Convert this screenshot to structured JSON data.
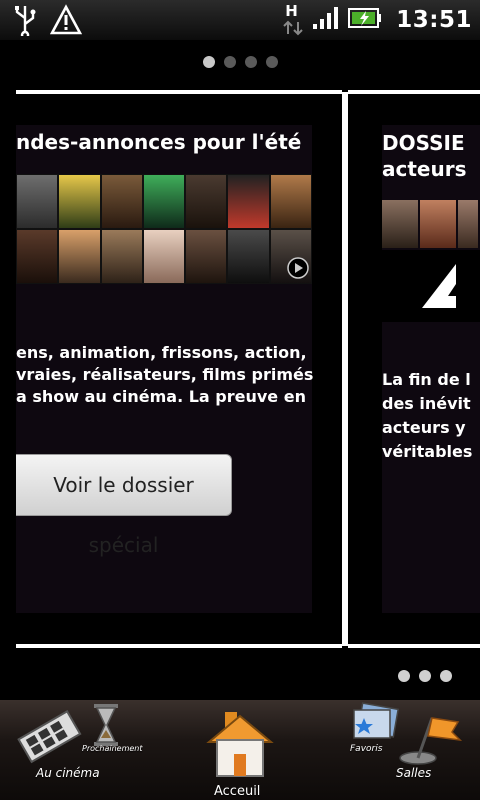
{
  "status_bar": {
    "time": "13:51",
    "network_label": "H",
    "icons": [
      "usb-icon",
      "warning-icon",
      "data-transfer-icon",
      "signal-icon",
      "battery-charging-icon"
    ]
  },
  "pager": {
    "top_page_count": 4,
    "top_active_index": 0,
    "bottom_page_count": 3,
    "cards": [
      {
        "title": "ndes-annonces pour l'été",
        "text_lines": [
          "ens, animation, frissons, action,",
          "vraies, réalisateurs, films primés",
          "a show au cinéma. La preuve en"
        ],
        "button_label": "Voir le dossier spécial"
      },
      {
        "title_lines": [
          "DOSSIE",
          "acteurs"
        ],
        "text_lines": [
          "La fin de l",
          "des inévit",
          "acteurs y",
          "véritables"
        ]
      }
    ]
  },
  "tab_bar": {
    "cinema_label": "Au cinéma",
    "next_label": "Prochainement",
    "home_label": "Acceuil",
    "favorites_label": "Favoris",
    "rooms_label": "Salles"
  }
}
